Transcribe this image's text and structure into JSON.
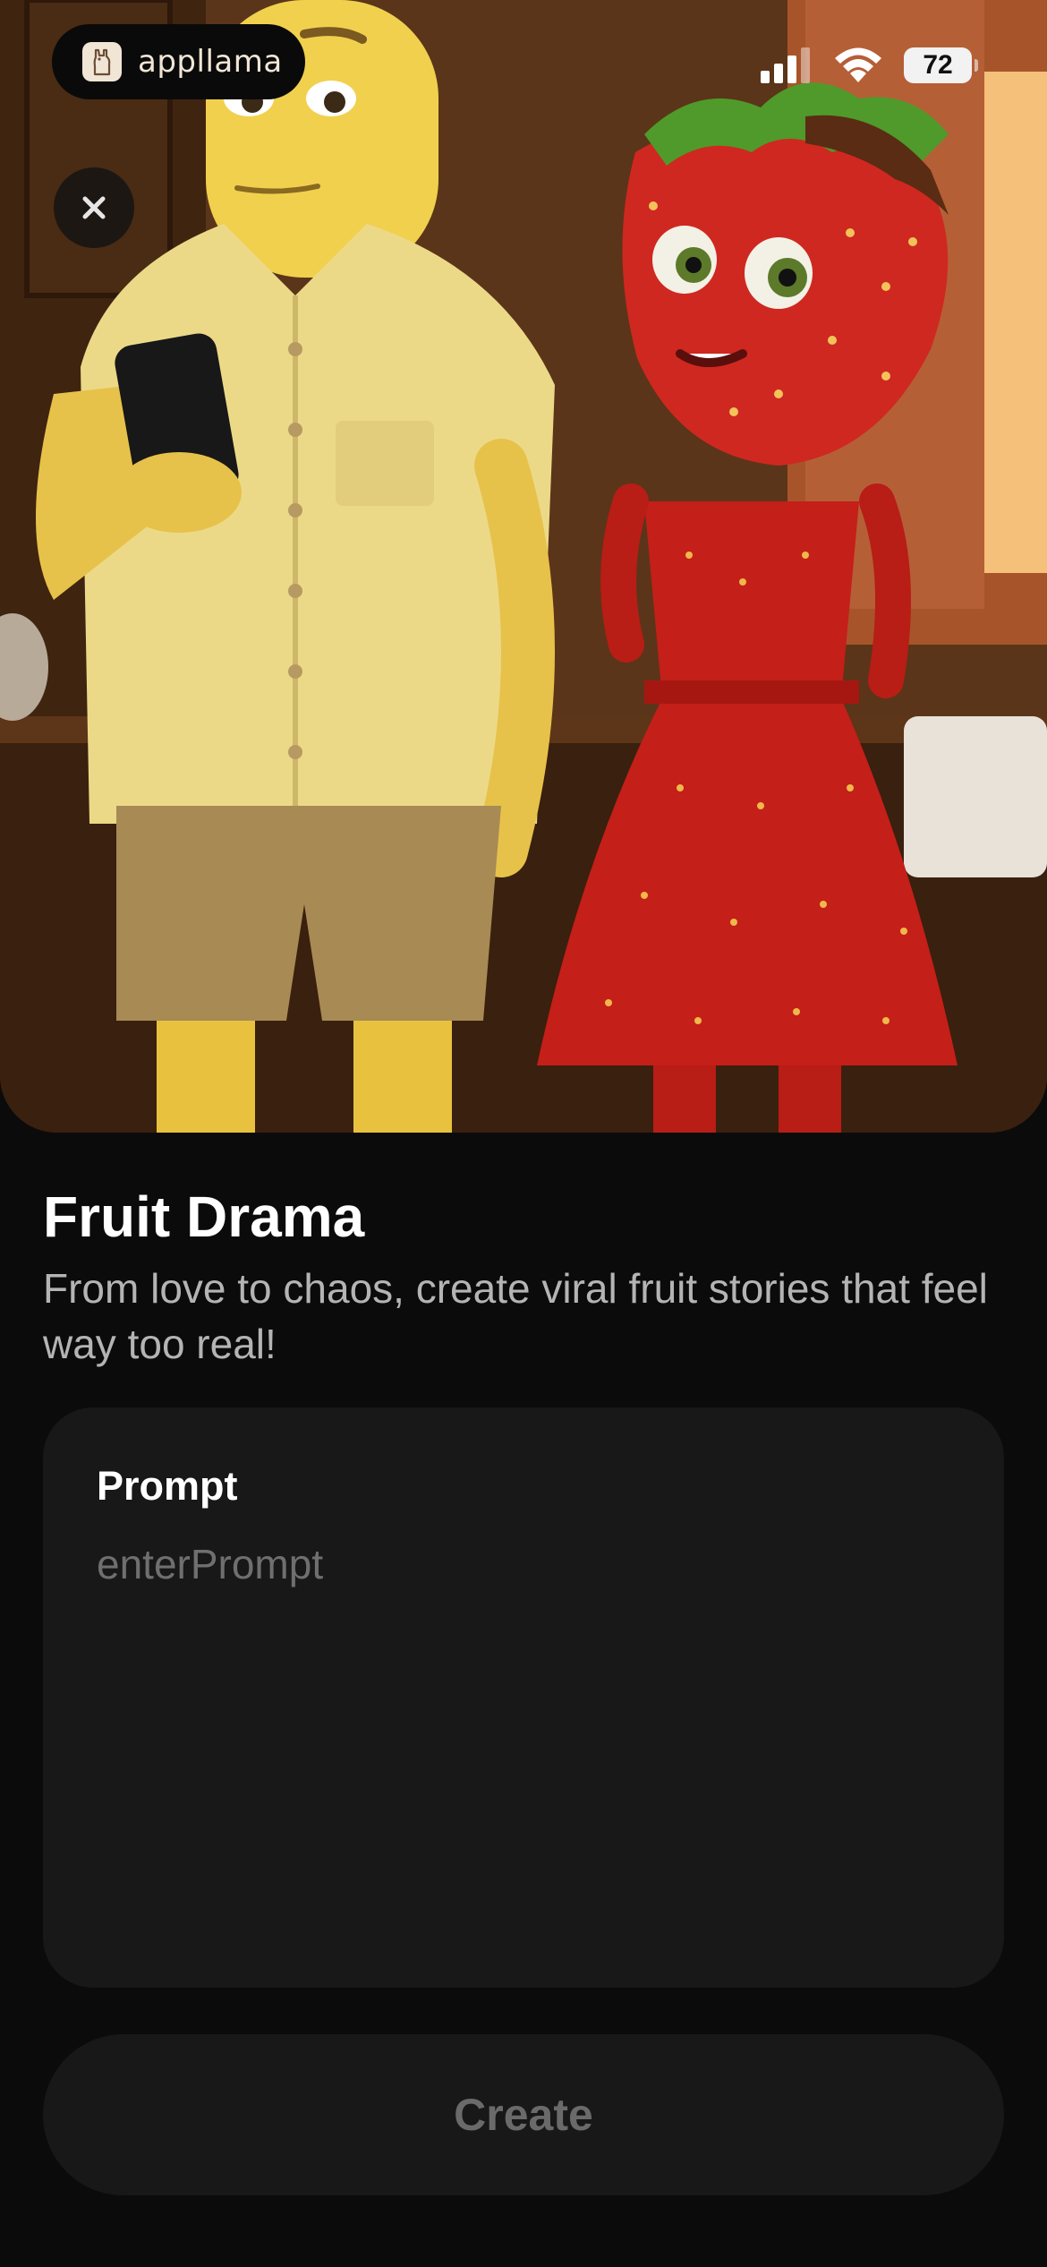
{
  "status_bar": {
    "app_name": "appllama",
    "battery": "72",
    "icons": [
      "cellular-signal-icon",
      "wifi-icon",
      "battery-icon"
    ]
  },
  "hero": {
    "icon": "close-icon",
    "description_colors": {
      "background": "#6d4220",
      "banana": "#f1d04e",
      "strawberry": "#c8211b"
    }
  },
  "content": {
    "title": "Fruit Drama",
    "subtitle": "From love to chaos, create viral fruit stories that feel way too real!"
  },
  "prompt": {
    "label": "Prompt",
    "value": "",
    "placeholder": "enterPrompt"
  },
  "actions": {
    "create_label": "Create"
  },
  "colors": {
    "background": "#0b0b0b",
    "card": "#181818",
    "subtitle_text": "#b4b4b4",
    "placeholder_text": "#6f6f6f",
    "disabled_button_text": "#6a6a6a"
  }
}
